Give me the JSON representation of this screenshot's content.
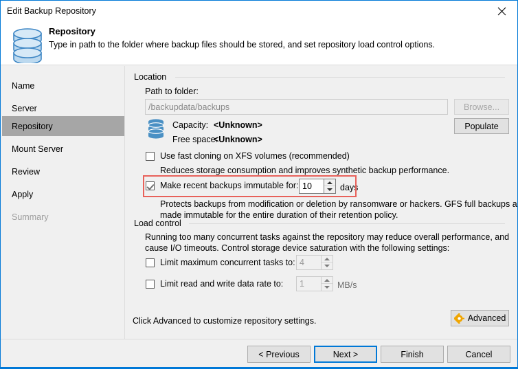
{
  "window": {
    "title": "Edit Backup Repository",
    "close_icon": "close-icon"
  },
  "header": {
    "icon": "repository-database-icon",
    "title": "Repository",
    "description": "Type in path to the folder where backup files should be stored, and set repository load control options."
  },
  "sidebar": {
    "items": [
      {
        "label": "Name",
        "state": "normal"
      },
      {
        "label": "Server",
        "state": "normal"
      },
      {
        "label": "Repository",
        "state": "selected"
      },
      {
        "label": "Mount Server",
        "state": "normal"
      },
      {
        "label": "Review",
        "state": "normal"
      },
      {
        "label": "Apply",
        "state": "normal"
      },
      {
        "label": "Summary",
        "state": "disabled"
      }
    ]
  },
  "location": {
    "group_label": "Location",
    "path_label": "Path to folder:",
    "path_value": "/backupdata/backups",
    "browse_label": "Browse...",
    "populate_label": "Populate",
    "storage_icon": "database-icon",
    "capacity_label": "Capacity:",
    "capacity_value": "<Unknown>",
    "free_space_label": "Free space:",
    "free_space_value": "<Unknown>",
    "fast_clone": {
      "label": "Use fast cloning on XFS volumes (recommended)",
      "checked": false,
      "description": "Reduces storage consumption and improves synthetic backup performance."
    },
    "immutable": {
      "label": "Make recent backups immutable for:",
      "checked": true,
      "days_value": "10",
      "unit_label": "days",
      "description_line1": "Protects backups from modification or deletion by ransomware or hackers. GFS full backups are",
      "description_line2": "made immutable for the entire duration of their retention policy.",
      "highlight_color": "#e8615a"
    }
  },
  "load_control": {
    "group_label": "Load control",
    "description_line1": "Running too many concurrent tasks against the repository may reduce overall performance, and",
    "description_line2": "cause I/O timeouts. Control storage device saturation with the following settings:",
    "limit_tasks": {
      "label": "Limit maximum concurrent tasks to:",
      "checked": false,
      "value": "4"
    },
    "limit_rate": {
      "label": "Limit read and write data rate to:",
      "checked": false,
      "value": "1",
      "unit_label": "MB/s"
    }
  },
  "advanced": {
    "hint_text": "Click Advanced to customize repository settings.",
    "button_label": "Advanced",
    "icon": "gear-icon",
    "icon_color": "#f0a500"
  },
  "footer": {
    "previous_label": "< Previous",
    "next_label": "Next >",
    "finish_label": "Finish",
    "cancel_label": "Cancel"
  },
  "theme": {
    "accent": "#0078d7",
    "selection_bg": "#a6a6a6",
    "dialog_bg": "#f0f0f0"
  }
}
